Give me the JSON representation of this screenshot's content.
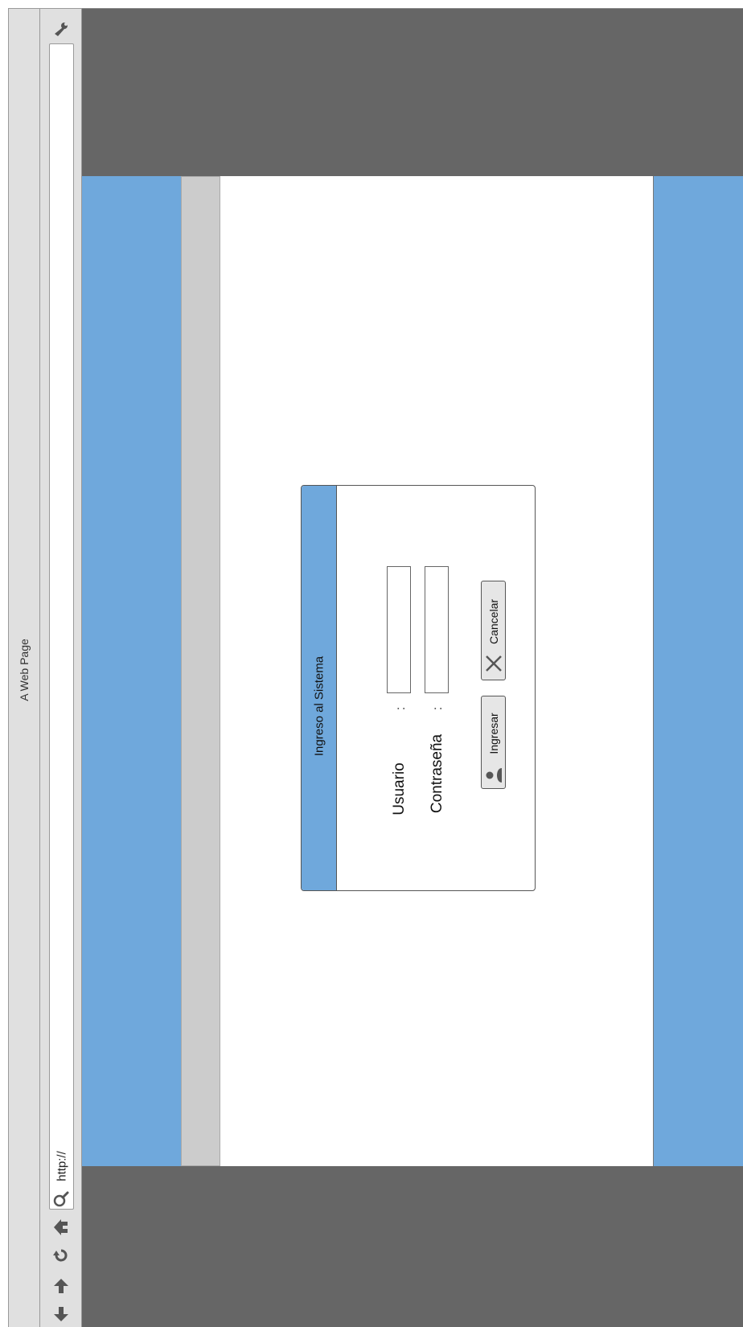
{
  "window": {
    "title": "A Web Page"
  },
  "toolbar": {
    "url": "http://",
    "icons": [
      "settings-icon",
      "back-icon",
      "forward-icon",
      "reload-icon",
      "home-icon",
      "search-icon"
    ]
  },
  "dialog": {
    "title": "Ingreso al Sistema",
    "user_label": "Usuario",
    "password_label": "Contraseña",
    "colon": ":",
    "user_value": "",
    "password_value": "",
    "login_button": "Ingresar",
    "cancel_button": "Cancelar"
  },
  "colors": {
    "accent": "#6fa8dc",
    "frame": "#666666",
    "chrome": "#e0e0e0",
    "side_bar": "#cccccc"
  }
}
